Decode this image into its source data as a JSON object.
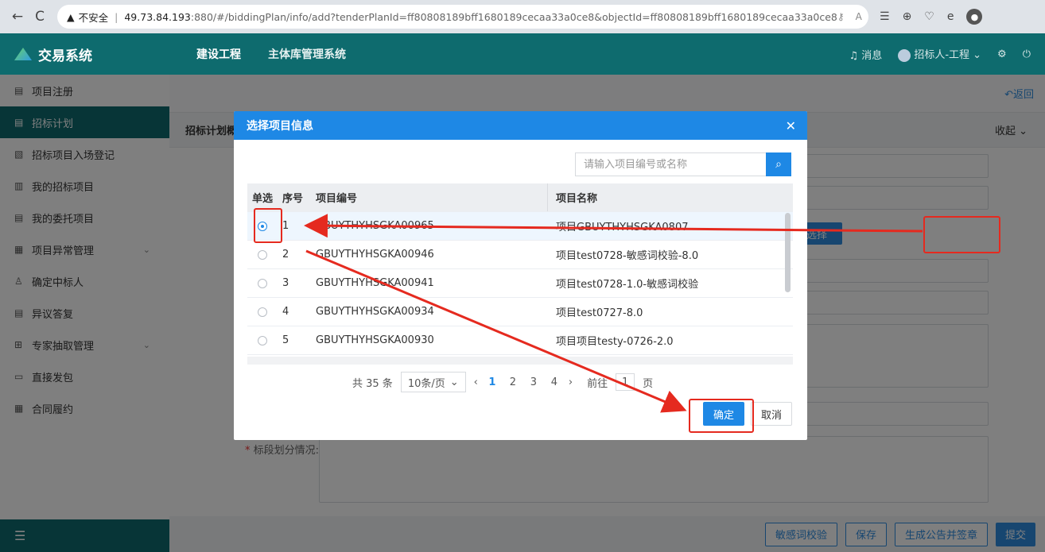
{
  "browser": {
    "back_icon": "←",
    "reload_icon": "C",
    "security_label": "不安全",
    "host": "49.73.84.193",
    "port_path": ":880/#/biddingPlan/info/add?tenderPlanId=ff80808189bff1680189cecaa33a0ce8&objectId=ff80808189bff1680189cecaa33a0ce8"
  },
  "header": {
    "brand": "交易系统",
    "nav": [
      "建设工程",
      "主体库管理系统"
    ],
    "message": "消息",
    "user": "招标人-工程"
  },
  "sidebar": {
    "items": [
      {
        "label": "项目注册",
        "icon": "▤"
      },
      {
        "label": "招标计划",
        "icon": "▤"
      },
      {
        "label": "招标项目入场登记",
        "icon": "▧"
      },
      {
        "label": "我的招标项目",
        "icon": "▥"
      },
      {
        "label": "我的委托项目",
        "icon": "▤"
      },
      {
        "label": "项目异常管理",
        "icon": "▦"
      },
      {
        "label": "确定中标人",
        "icon": "♙"
      },
      {
        "label": "异议答复",
        "icon": "▤"
      },
      {
        "label": "专家抽取管理",
        "icon": "⊞"
      },
      {
        "label": "直接发包",
        "icon": "▭"
      },
      {
        "label": "合同履约",
        "icon": "▦"
      }
    ],
    "footer_icon": "☰"
  },
  "main": {
    "back_label": "返回",
    "section_title": "招标计划概",
    "collapse_label": "收起",
    "select_button": "选择",
    "division_label": "标段划分情况:",
    "actions": [
      "敏感词校验",
      "保存",
      "生成公告并签章",
      "提交"
    ]
  },
  "modal": {
    "title": "选择项目信息",
    "search_placeholder": "请输入项目编号或名称",
    "columns": [
      "单选",
      "序号",
      "项目编号",
      "项目名称"
    ],
    "rows": [
      {
        "no": "1",
        "code": "GBUYTHYHSGKA00965",
        "name": "项目GBUYTHYHSGKA0807",
        "selected": true
      },
      {
        "no": "2",
        "code": "GBUYTHYHSGKA00946",
        "name": "项目test0728-敏感词校验-8.0",
        "selected": false
      },
      {
        "no": "3",
        "code": "GBUYTHYHSGKA00941",
        "name": "项目test0728-1.0-敏感词校验",
        "selected": false
      },
      {
        "no": "4",
        "code": "GBUYTHYHSGKA00934",
        "name": "项目test0727-8.0",
        "selected": false
      },
      {
        "no": "5",
        "code": "GBUYTHYHSGKA00930",
        "name": "项目项目testy-0726-2.0",
        "selected": false
      }
    ],
    "pager": {
      "total": "共 35 条",
      "page_size": "10条/页",
      "pages": [
        "1",
        "2",
        "3",
        "4"
      ],
      "current": "1",
      "goto_prefix": "前往",
      "goto_value": "1",
      "goto_suffix": "页"
    },
    "ok_label": "确定",
    "cancel_label": "取消"
  },
  "colors": {
    "header_bg": "#0e6b6e",
    "primary": "#1e88e5",
    "annotation": "#e52a1f"
  }
}
